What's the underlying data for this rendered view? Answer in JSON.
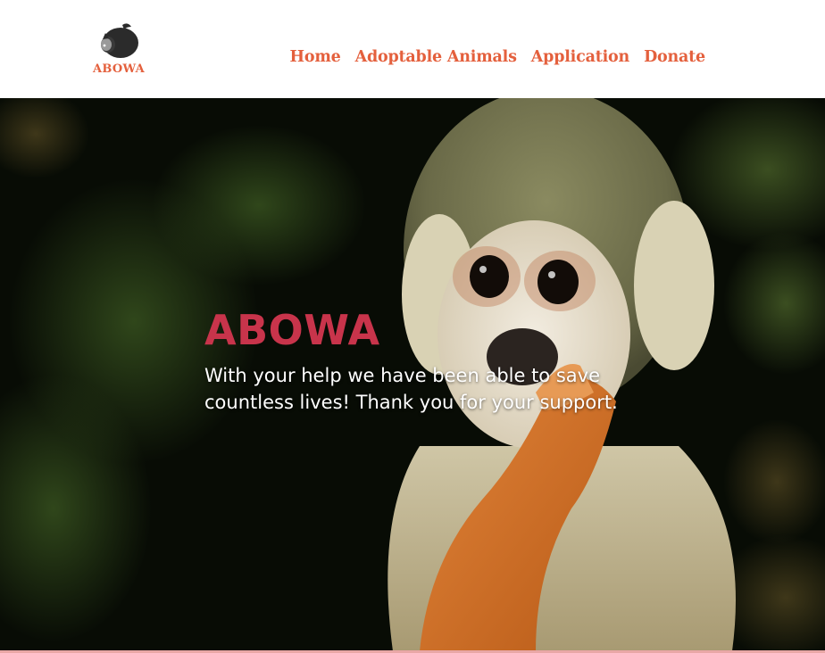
{
  "brand": {
    "logo_text": "ABOWA",
    "logo_icon": "sleeping-animal-icon"
  },
  "nav": {
    "items": [
      {
        "label": "Home"
      },
      {
        "label": "Adoptable Animals"
      },
      {
        "label": "Application"
      },
      {
        "label": "Donate"
      }
    ]
  },
  "hero": {
    "title": "ABOWA",
    "text": "With your help we have been able to save countless lives! Thank you for your support.",
    "image": "squirrel-monkey-photo"
  },
  "colors": {
    "accent": "#e4603d",
    "hero_title": "#c8344b",
    "hero_text": "#ffffff",
    "hero_bg": "#080c05",
    "bottom_border": "#e9a7a6"
  }
}
